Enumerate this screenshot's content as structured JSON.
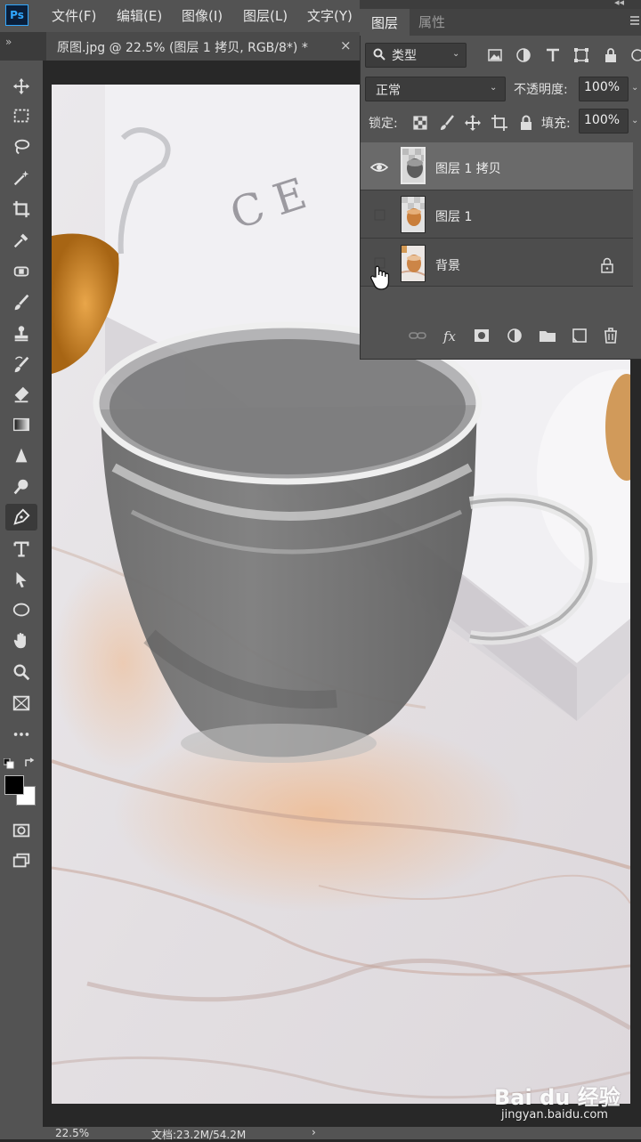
{
  "app": {
    "logo": "Ps"
  },
  "menubar": {
    "items": [
      "文件(F)",
      "编辑(E)",
      "图像(I)",
      "图层(L)",
      "文字(Y)"
    ]
  },
  "document": {
    "tab_title": "原图.jpg @ 22.5% (图层 1 拷贝, RGB/8*) *",
    "close": "×"
  },
  "toolbar": {
    "tools": [
      "move-icon",
      "marquee-icon",
      "lasso-icon",
      "magic-wand-icon",
      "crop-icon",
      "eyedropper-icon",
      "healing-brush-icon",
      "brush-icon",
      "clone-stamp-icon",
      "history-brush-icon",
      "eraser-icon",
      "gradient-icon",
      "blur-icon",
      "dodge-icon",
      "pen-icon",
      "type-icon",
      "path-selection-icon",
      "ellipse-icon",
      "hand-icon",
      "zoom-icon",
      "frame-icon",
      "more-icon"
    ],
    "active_tool": "pen-icon",
    "foreground_color": "#000000",
    "background_color": "#ffffff"
  },
  "layers_panel": {
    "tabs": [
      "图层",
      "属性"
    ],
    "filter": {
      "label": "类型"
    },
    "blend_mode": "正常",
    "opacity_label": "不透明度:",
    "opacity_value": "100%",
    "lock_label": "锁定:",
    "fill_label": "填充:",
    "fill_value": "100%",
    "layers": [
      {
        "name": "图层 1 拷贝",
        "visible": true,
        "selected": true,
        "locked": false
      },
      {
        "name": "图层 1",
        "visible": false,
        "selected": false,
        "locked": false
      },
      {
        "name": "背景",
        "visible": false,
        "selected": false,
        "locked": true
      }
    ]
  },
  "status": {
    "zoom": "22.5%",
    "doc_size": "文档:23.2M/54.2M",
    "arrow": "›"
  },
  "watermark": {
    "logo": "Bai du 经验",
    "url": "jingyan.baidu.com"
  }
}
